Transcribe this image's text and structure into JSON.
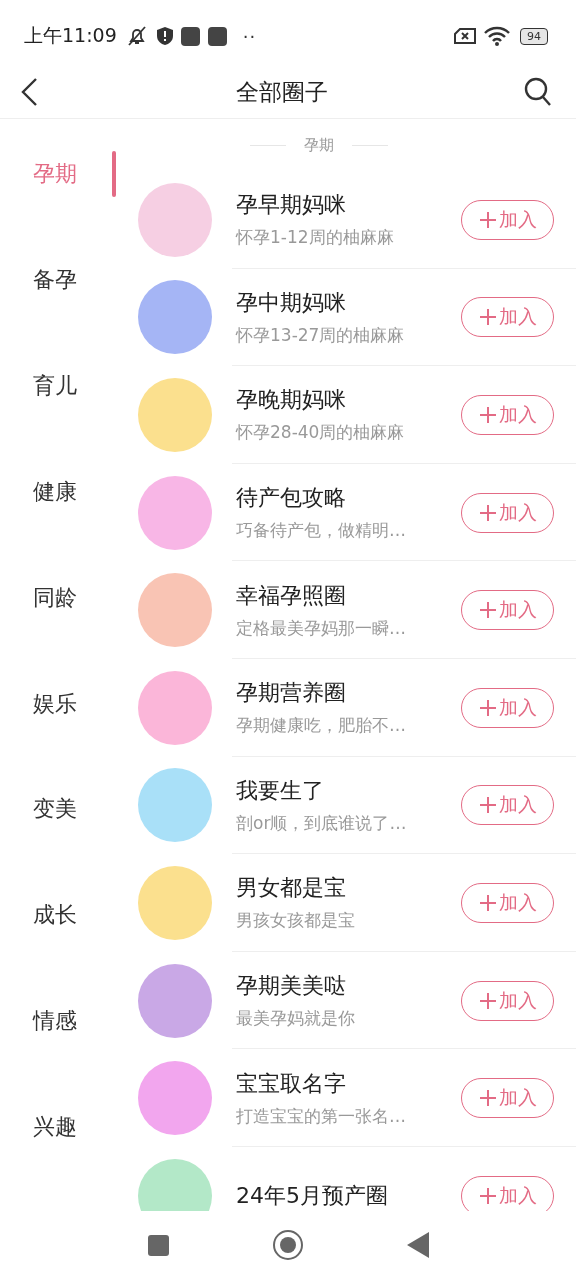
{
  "status_bar": {
    "time": "上午11:09",
    "notification_more": "··",
    "battery": "94"
  },
  "header": {
    "title": "全部圈子"
  },
  "sidebar": {
    "items": [
      {
        "label": "孕期",
        "selected": true
      },
      {
        "label": "备孕",
        "selected": false
      },
      {
        "label": "育儿",
        "selected": false
      },
      {
        "label": "健康",
        "selected": false
      },
      {
        "label": "同龄",
        "selected": false
      },
      {
        "label": "娱乐",
        "selected": false
      },
      {
        "label": "变美",
        "selected": false
      },
      {
        "label": "成长",
        "selected": false
      },
      {
        "label": "情感",
        "selected": false
      },
      {
        "label": "兴趣",
        "selected": false
      }
    ]
  },
  "section": {
    "title": "孕期"
  },
  "circles": [
    {
      "name": "孕早期妈咪",
      "description": "怀孕1-12周的柚麻麻",
      "color": "#f6cfe3",
      "button": "加入"
    },
    {
      "name": "孕中期妈咪",
      "description": "怀孕13-27周的柚麻麻",
      "color": "#a5b5f5",
      "button": "加入"
    },
    {
      "name": "孕晚期妈咪",
      "description": "怀孕28-40周的柚麻麻",
      "color": "#fbe08e",
      "button": "加入"
    },
    {
      "name": "待产包攻略",
      "description": "巧备待产包，做精明…",
      "color": "#f8b6e6",
      "button": "加入"
    },
    {
      "name": "幸福孕照圈",
      "description": "定格最美孕妈那一瞬…",
      "color": "#f9c4b4",
      "button": "加入"
    },
    {
      "name": "孕期营养圈",
      "description": "孕期健康吃，肥胎不…",
      "color": "#fbb6d9",
      "button": "加入"
    },
    {
      "name": "我要生了",
      "description": "剖or顺，到底谁说了…",
      "color": "#a9e0f8",
      "button": "加入"
    },
    {
      "name": "男女都是宝",
      "description": "男孩女孩都是宝",
      "color": "#fbe08e",
      "button": "加入"
    },
    {
      "name": "孕期美美哒",
      "description": "最美孕妈就是你",
      "color": "#c9a8e6",
      "button": "加入"
    },
    {
      "name": "宝宝取名字",
      "description": "打造宝宝的第一张名…",
      "color": "#f2a6ee",
      "button": "加入"
    },
    {
      "name": "24年5月预产圈",
      "color": "#b3e8c8",
      "button": "加入"
    }
  ]
}
